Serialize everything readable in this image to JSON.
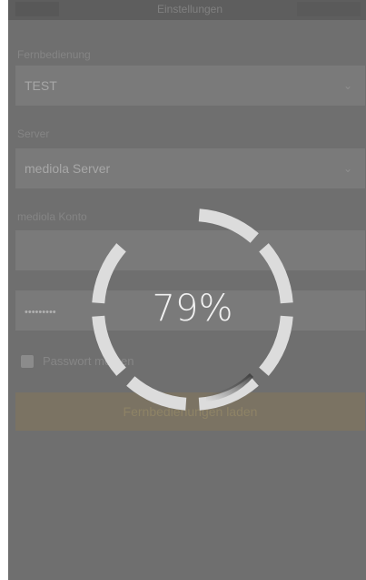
{
  "header": {
    "tab_left": "",
    "tab_center": "Einstellungen",
    "tab_right": ""
  },
  "form": {
    "section1_label": "Fernbedienung",
    "remote_value": "TEST",
    "section2_label": "Server",
    "server_value": "mediola Server",
    "section3_label": "mediola Konto",
    "email_value": "",
    "password_value": "•••••••••",
    "checkbox_label": "Passwort merken",
    "load_button_label": "Fernbedienungen laden"
  },
  "progress": {
    "percent_text": "79%",
    "value": 0.79
  },
  "colors": {
    "overlay": "#6f6f6f",
    "ring": "#dcdcdc",
    "button": "#7b7363"
  }
}
